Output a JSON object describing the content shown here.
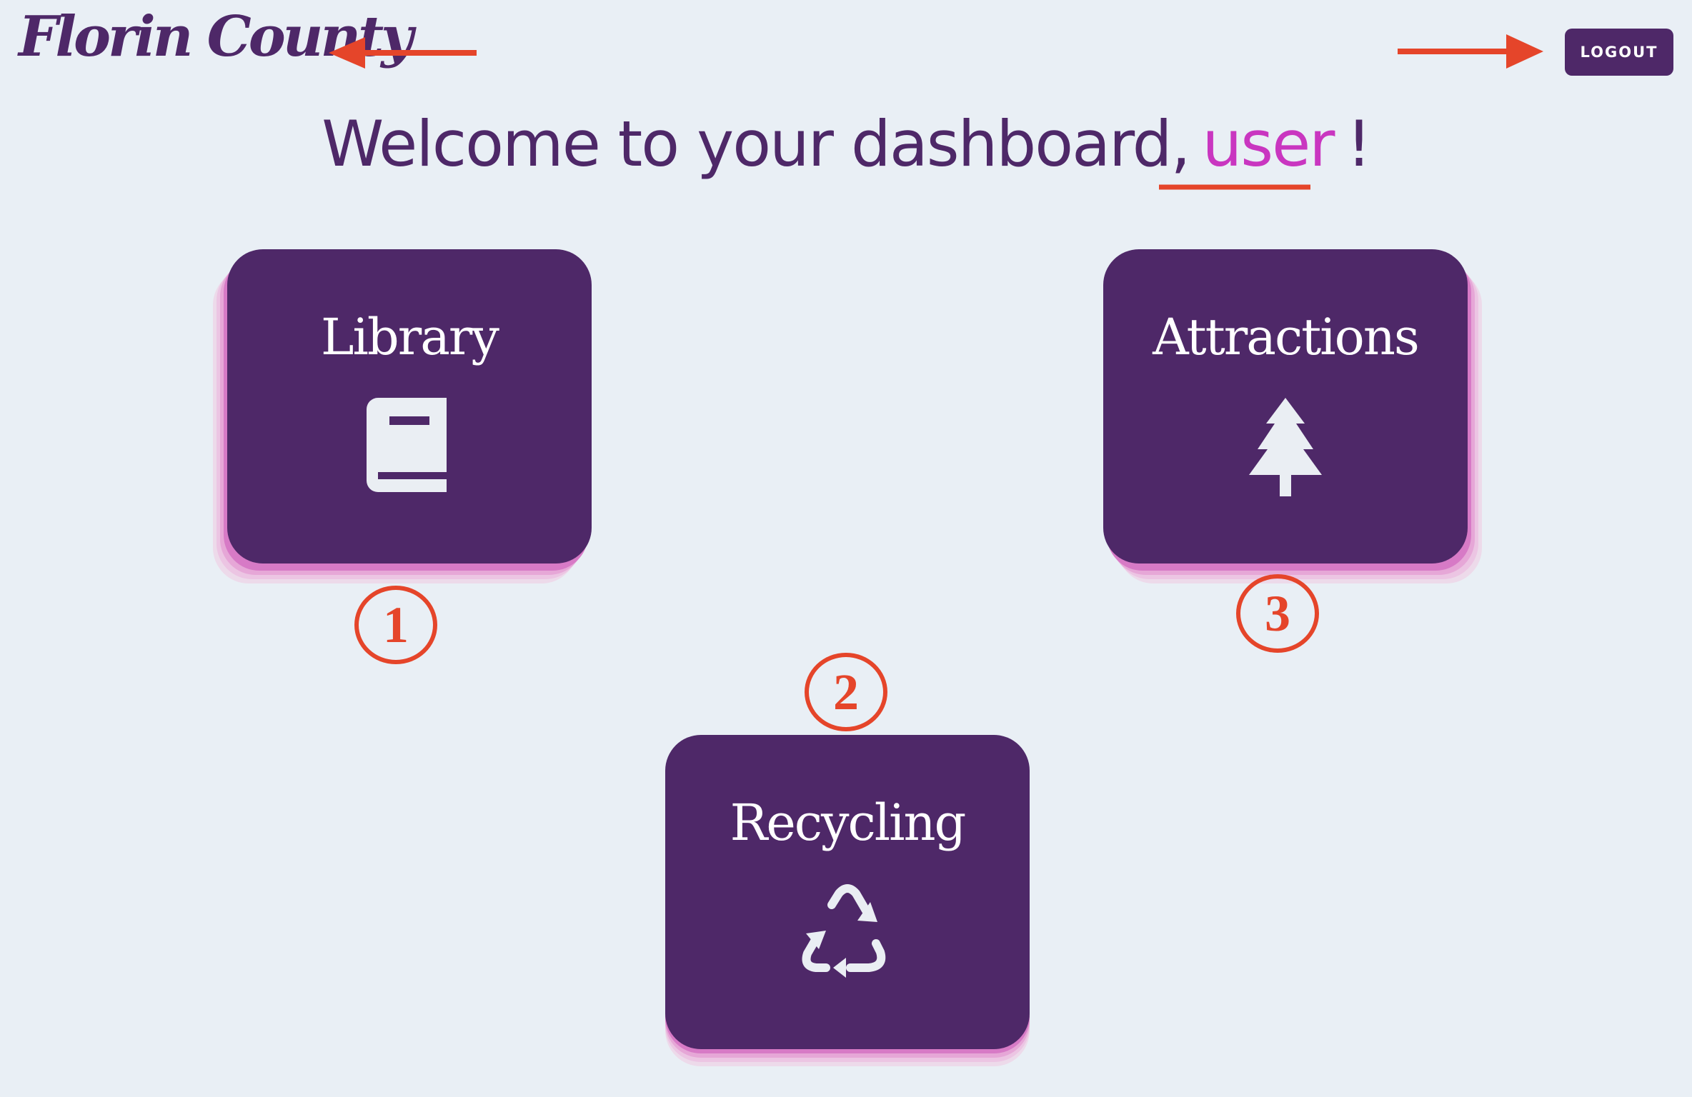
{
  "header": {
    "logo_text": "Florin County",
    "logout_label": "LOGOUT"
  },
  "welcome": {
    "prefix": "Welcome to your dashboard,",
    "username": "user",
    "suffix": "!"
  },
  "cards": [
    {
      "title": "Library",
      "icon": "book-icon"
    },
    {
      "title": "Attractions",
      "icon": "tree-icon"
    },
    {
      "title": "Recycling",
      "icon": "recycle-icon"
    }
  ],
  "annotations": {
    "badges": [
      "1",
      "2",
      "3"
    ]
  },
  "colors": {
    "background": "#e9eff5",
    "primary": "#4e2868",
    "accent": "#c936c0",
    "card_stack": "#d77ac6",
    "annotation": "#e5452a",
    "icon": "#eaeef3"
  }
}
